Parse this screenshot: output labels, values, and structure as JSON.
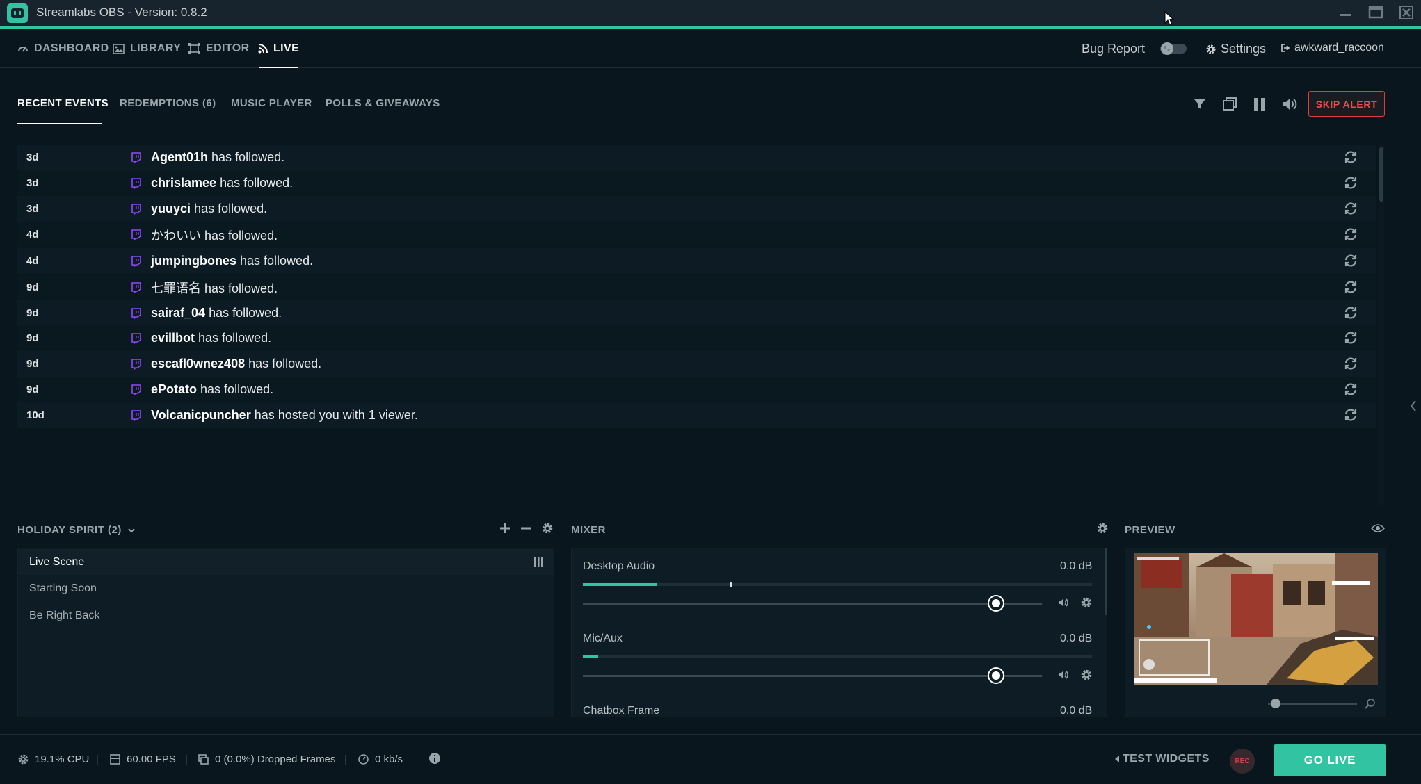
{
  "window": {
    "title": "Streamlabs OBS - Version: 0.8.2"
  },
  "nav": {
    "items": [
      {
        "label": "DASHBOARD",
        "icon": "dashboard-icon"
      },
      {
        "label": "LIBRARY",
        "icon": "image-icon"
      },
      {
        "label": "EDITOR",
        "icon": "editor-icon"
      },
      {
        "label": "LIVE",
        "icon": "rss-icon",
        "active": true
      }
    ],
    "bug_report": "Bug Report",
    "settings": "Settings",
    "user": "awkward_raccoon"
  },
  "tabs": [
    {
      "label": "RECENT EVENTS",
      "active": true
    },
    {
      "label": "REDEMPTIONS (6)"
    },
    {
      "label": "MUSIC PLAYER"
    },
    {
      "label": "POLLS & GIVEAWAYS"
    }
  ],
  "toolbar": {
    "skip_alert": "SKIP ALERT"
  },
  "events": [
    {
      "time": "3d",
      "user": "Agent01h",
      "action": "has followed.",
      "bold": true
    },
    {
      "time": "3d",
      "user": "chrislamee",
      "action": "has followed.",
      "bold": true
    },
    {
      "time": "3d",
      "user": "yuuyci",
      "action": "has followed.",
      "bold": true
    },
    {
      "time": "4d",
      "user": "かわいい",
      "action": "has followed.",
      "bold": false
    },
    {
      "time": "4d",
      "user": "jumpingbones",
      "action": "has followed.",
      "bold": true
    },
    {
      "time": "9d",
      "user": "七罪语名",
      "action": "has followed.",
      "bold": false
    },
    {
      "time": "9d",
      "user": "sairaf_04",
      "action": "has followed.",
      "bold": true
    },
    {
      "time": "9d",
      "user": "evillbot",
      "action": "has followed.",
      "bold": true
    },
    {
      "time": "9d",
      "user": "escafl0wnez408",
      "action": "has followed.",
      "bold": true
    },
    {
      "time": "9d",
      "user": "ePotato",
      "action": "has followed.",
      "bold": true
    },
    {
      "time": "10d",
      "user": "Volcanicpuncher",
      "action": "has hosted you with 1 viewer.",
      "bold": true
    }
  ],
  "scenes": {
    "title": "HOLIDAY SPIRIT (2)",
    "items": [
      {
        "label": "Live Scene",
        "active": true
      },
      {
        "label": "Starting Soon"
      },
      {
        "label": "Be Right Back"
      }
    ]
  },
  "mixer": {
    "title": "MIXER",
    "sources": [
      {
        "name": "Desktop Audio",
        "db": "0.0 dB",
        "level": 0.145,
        "peak": 0.29,
        "volume": 0.9
      },
      {
        "name": "Mic/Aux",
        "db": "0.0 dB",
        "level": 0.03,
        "peak": 0.03,
        "volume": 0.9
      },
      {
        "name": "Chatbox Frame",
        "db": "0.0 dB"
      }
    ]
  },
  "preview": {
    "title": "PREVIEW"
  },
  "footer": {
    "cpu": "19.1% CPU",
    "fps": "60.00 FPS",
    "dropped": "0 (0.0%) Dropped Frames",
    "bandwidth": "0 kb/s",
    "test_widgets": "TEST WIDGETS",
    "rec": "REC",
    "go_live": "GO LIVE"
  },
  "colors": {
    "accent": "#31c3a2",
    "twitch": "#9146ff",
    "alert": "#e03c3c"
  }
}
